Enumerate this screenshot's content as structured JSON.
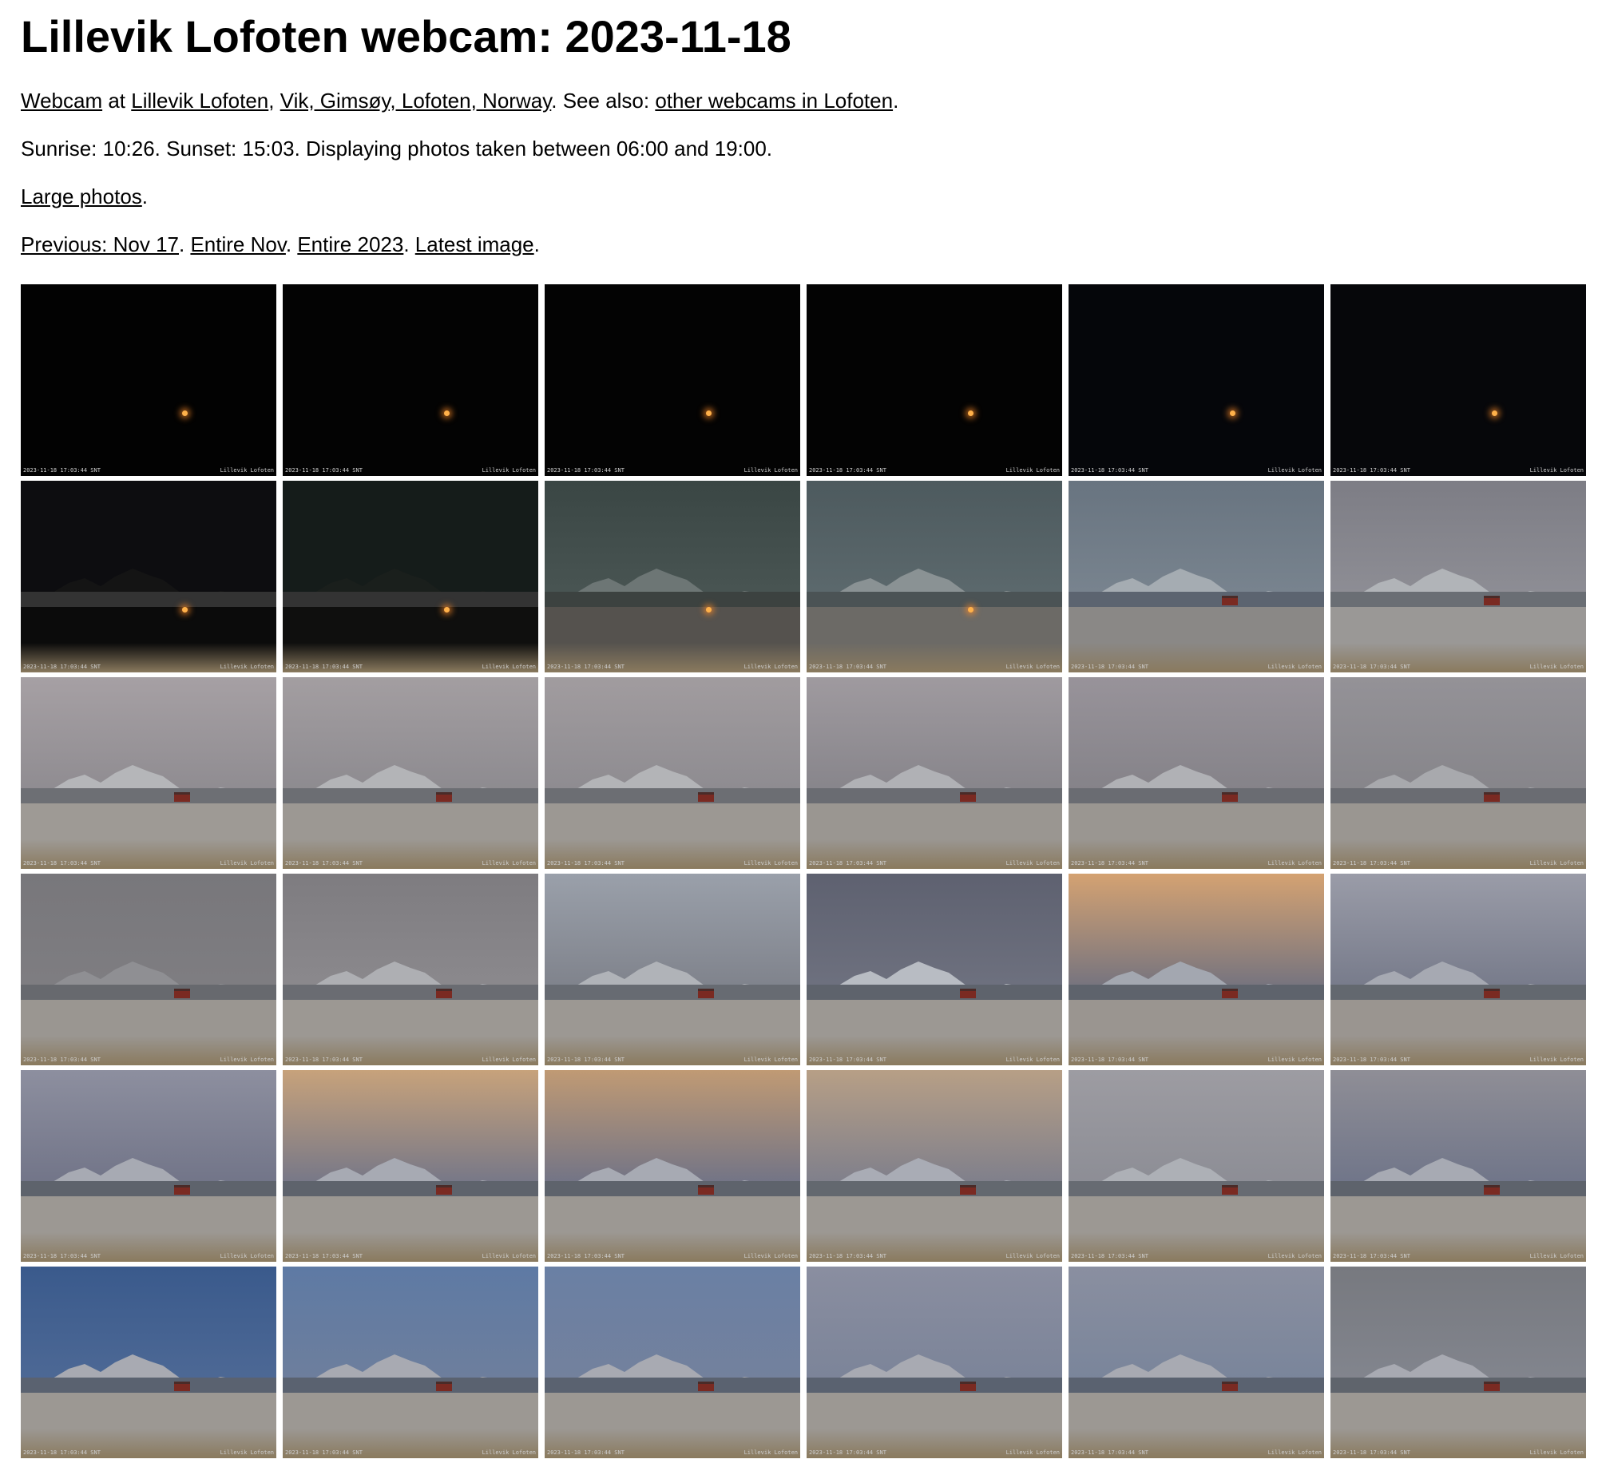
{
  "title": "Lillevik Lofoten webcam: 2023-11-18",
  "location": {
    "webcam_link": "Webcam",
    "at": " at ",
    "place_link": "Lillevik Lofoten",
    "sep1": ", ",
    "region_link": "Vik, Gimsøy, Lofoten, Norway",
    "see_also": ". See also: ",
    "other_link": "other webcams in Lofoten",
    "end": "."
  },
  "sun": {
    "text": "Sunrise: 10:26. Sunset: 15:03. Displaying photos taken between 06:00 and 19:00."
  },
  "size": {
    "large_link": "Large photos",
    "end": "."
  },
  "nav": {
    "previous_link": "Previous: Nov 17",
    "sep1": ". ",
    "month_link": "Entire Nov",
    "sep2": ". ",
    "year_link": "Entire 2023",
    "sep3": ". ",
    "latest_link": "Latest image",
    "end": "."
  },
  "photo_stamp_left": "2023-11-18 17:03:44 SNT",
  "photo_stamp_right": "Lillevik Lofoten",
  "photos": [
    {
      "kind": "night",
      "sky": "#020202",
      "light": [
        0.63,
        0.66
      ]
    },
    {
      "kind": "night",
      "sky": "#030303",
      "light": [
        0.63,
        0.66
      ]
    },
    {
      "kind": "night",
      "sky": "#030303",
      "light": [
        0.63,
        0.66
      ]
    },
    {
      "kind": "night",
      "sky": "#030303",
      "light": [
        0.63,
        0.66
      ]
    },
    {
      "kind": "night",
      "sky": "#05060a",
      "light": [
        0.63,
        0.66
      ]
    },
    {
      "kind": "night",
      "sky": "#06070a",
      "light": [
        0.63,
        0.66
      ]
    },
    {
      "kind": "dusk",
      "sky": "#0d0d10",
      "mtn": "#141414",
      "ground": "#0b0b0b",
      "light": [
        0.63,
        0.66
      ]
    },
    {
      "kind": "dusk",
      "sky": "#151c1a",
      "mtn": "#1a1f1c",
      "ground": "#0f0f0e",
      "light": [
        0.63,
        0.66
      ]
    },
    {
      "kind": "day",
      "sky": "#4a5654",
      "skyTop": "#3a4644",
      "mtn": "#6d7675",
      "ground": "#55524e",
      "water": "#3c4240",
      "light": [
        0.63,
        0.66
      ]
    },
    {
      "kind": "day",
      "sky": "#5d6a6e",
      "skyTop": "#4d5a5e",
      "mtn": "#8a9294",
      "ground": "#6c6a66",
      "water": "#4b5355",
      "light": [
        0.63,
        0.66
      ]
    },
    {
      "kind": "day",
      "sky": "#7a8590",
      "skyTop": "#687480",
      "mtn": "#a5acb2",
      "ground": "#8a8886",
      "water": "#5c6470",
      "house": [
        0.6
      ]
    },
    {
      "kind": "day",
      "sky": "#8f8f96",
      "skyTop": "#7d7d85",
      "mtn": "#b1b4b8",
      "ground": "#9a9896",
      "water": "#6a6e74",
      "house": [
        0.6
      ]
    },
    {
      "kind": "day",
      "sky": "#8d8a8f",
      "skyTop": "#a6a0a4",
      "mtn": "#b5b6b9",
      "ground": "#9e9a95",
      "water": "#6d6f74",
      "house": [
        0.6
      ]
    },
    {
      "kind": "day",
      "sky": "#8b898e",
      "skyTop": "#a39ea1",
      "mtn": "#b3b4b7",
      "ground": "#9c9893",
      "water": "#6c6e73",
      "house": [
        0.6
      ]
    },
    {
      "kind": "day",
      "sky": "#8c8a8f",
      "skyTop": "#a19c9f",
      "mtn": "#b3b4b7",
      "ground": "#9c9893",
      "water": "#6c6e73",
      "house": [
        0.6
      ]
    },
    {
      "kind": "day",
      "sky": "#858389",
      "skyTop": "#9f9a9f",
      "mtn": "#b0b1b5",
      "ground": "#9a9691",
      "water": "#6a6c72",
      "house": [
        0.6
      ]
    },
    {
      "kind": "day",
      "sky": "#838187",
      "skyTop": "#98939a",
      "mtn": "#b0b1b5",
      "ground": "#9a9691",
      "water": "#6a6c72",
      "house": [
        0.6
      ]
    },
    {
      "kind": "day",
      "sky": "#858489",
      "skyTop": "#949297",
      "mtn": "#a8a9ad",
      "ground": "#9a9691",
      "water": "#6a6c72",
      "house": [
        0.6
      ]
    },
    {
      "kind": "day",
      "sky": "#7f7e82",
      "skyTop": "#78777b",
      "mtn": "#8f8f93",
      "ground": "#9a9691",
      "water": "#67696e",
      "house": [
        0.6
      ]
    },
    {
      "kind": "day",
      "sky": "#8c8a8e",
      "skyTop": "#7e7c80",
      "mtn": "#aeafb3",
      "ground": "#9c9893",
      "water": "#6a6c72",
      "house": [
        0.6
      ]
    },
    {
      "kind": "day",
      "sky": "#7d8089",
      "skyTop": "#9aa0aa",
      "mtn": "#b0b3b8",
      "ground": "#9c9893",
      "water": "#676b72",
      "house": [
        0.6
      ]
    },
    {
      "kind": "day",
      "sky": "#6f7280",
      "skyTop": "#5e6170",
      "mtn": "#b8bcc3",
      "ground": "#9c9893",
      "water": "#5e636c",
      "house": [
        0.6
      ]
    },
    {
      "kind": "day",
      "sky": "#6c6f80",
      "skyTop": "#d4a272",
      "mtn": "#a3a7b0",
      "ground": "#9a9590",
      "water": "#5e636c",
      "house": [
        0.6
      ]
    },
    {
      "kind": "day",
      "sky": "#747888",
      "skyTop": "#9a9ca8",
      "mtn": "#a6a9b2",
      "ground": "#9a9590",
      "water": "#63686f",
      "house": [
        0.6
      ]
    },
    {
      "kind": "day",
      "sky": "#6f7286",
      "skyTop": "#8d8f9f",
      "mtn": "#a7aab3",
      "ground": "#9c9893",
      "water": "#5e636c",
      "house": [
        0.6
      ]
    },
    {
      "kind": "day",
      "sky": "#6e7389",
      "skyTop": "#c7a27b",
      "mtn": "#a7aab3",
      "ground": "#9c9893",
      "water": "#5e636c",
      "house": [
        0.6
      ]
    },
    {
      "kind": "day",
      "sky": "#6a7088",
      "skyTop": "#c09a74",
      "mtn": "#a7aab3",
      "ground": "#9c9893",
      "water": "#5e636c",
      "house": [
        0.6
      ]
    },
    {
      "kind": "day",
      "sky": "#797c8c",
      "skyTop": "#b79f86",
      "mtn": "#a9acb5",
      "ground": "#9c9893",
      "water": "#63686f",
      "house": [
        0.6
      ]
    },
    {
      "kind": "day",
      "sky": "#8b8c94",
      "skyTop": "#9d9ca2",
      "mtn": "#adb0b6",
      "ground": "#9c9893",
      "water": "#676b72",
      "house": [
        0.6
      ]
    },
    {
      "kind": "day",
      "sky": "#6d7388",
      "skyTop": "#8f8e96",
      "mtn": "#a7aab3",
      "ground": "#9c9893",
      "water": "#5e636c",
      "house": [
        0.6
      ]
    },
    {
      "kind": "day",
      "sky": "#4f6a96",
      "skyTop": "#3a5a8c",
      "mtn": "#a8aab2",
      "ground": "#9c9893",
      "water": "#5a6270",
      "house": [
        0.6
      ]
    },
    {
      "kind": "day",
      "sky": "#6f7f9c",
      "skyTop": "#5e7aa4",
      "mtn": "#a8aab2",
      "ground": "#9c9893",
      "water": "#5a6270",
      "house": [
        0.6
      ]
    },
    {
      "kind": "day",
      "sky": "#74819c",
      "skyTop": "#6a80a4",
      "mtn": "#a8aab2",
      "ground": "#9c9893",
      "water": "#5a6270",
      "house": [
        0.6
      ]
    },
    {
      "kind": "day",
      "sky": "#7a8398",
      "skyTop": "#8a8ea0",
      "mtn": "#a8aab2",
      "ground": "#9c9893",
      "water": "#5a6270",
      "house": [
        0.6
      ]
    },
    {
      "kind": "day",
      "sky": "#78849a",
      "skyTop": "#8a8fa0",
      "mtn": "#a8aab2",
      "ground": "#9c9893",
      "water": "#5a6270",
      "house": [
        0.6
      ]
    },
    {
      "kind": "day",
      "sky": "#83868f",
      "skyTop": "#77797f",
      "mtn": "#a8aab2",
      "ground": "#9c9893",
      "water": "#5f646c",
      "house": [
        0.6
      ]
    }
  ]
}
